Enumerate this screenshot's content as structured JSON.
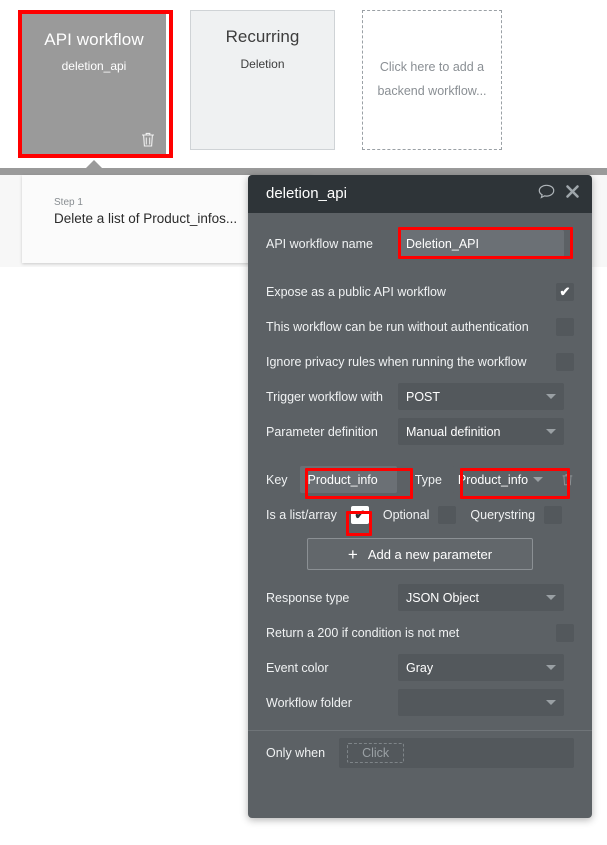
{
  "workflow_cards": [
    {
      "title": "API workflow",
      "subtitle": "deletion_api",
      "selected": true,
      "trash_icon": "trash-icon"
    },
    {
      "title": "Recurring",
      "subtitle": "Deletion",
      "selected": false
    },
    {
      "add_text": "Click here to add a backend workflow..."
    }
  ],
  "step": {
    "label": "Step 1",
    "title": "Delete a list of Product_infos..."
  },
  "panel": {
    "title": "deletion_api",
    "comment_icon": "speech-bubble-icon",
    "close_icon": "close-icon",
    "fields": {
      "api_workflow_name_label": "API workflow name",
      "api_workflow_name_value": "Deletion_API",
      "expose_public_label": "Expose as a public API workflow",
      "expose_public_checked": "✔",
      "no_auth_label": "This workflow can be run without authentication",
      "ignore_privacy_label": "Ignore privacy rules when running the workflow",
      "trigger_label": "Trigger workflow with",
      "trigger_value": "POST",
      "param_def_label": "Parameter definition",
      "param_def_value": "Manual definition",
      "key_label": "Key",
      "key_value": "Product_info",
      "type_label": "Type",
      "type_value": "Product_info",
      "param_trash_icon": "trash-icon",
      "is_list_label": "Is a list/array",
      "is_list_checked": "✔",
      "optional_label": "Optional",
      "querystring_label": "Querystring",
      "add_parameter_label": "Add a new parameter",
      "add_parameter_plus": "+",
      "response_type_label": "Response type",
      "response_type_value": "JSON Object",
      "return_200_label": "Return a 200 if condition is not met",
      "event_color_label": "Event color",
      "event_color_value": "Gray",
      "workflow_folder_label": "Workflow folder",
      "workflow_folder_value": "",
      "only_when_label": "Only when",
      "only_when_placeholder": "Click"
    }
  },
  "colors": {
    "highlight": "#ff0000",
    "panel_bg": "#5c6165",
    "panel_header": "#2e3438",
    "selected_card": "#9a9a9a"
  }
}
